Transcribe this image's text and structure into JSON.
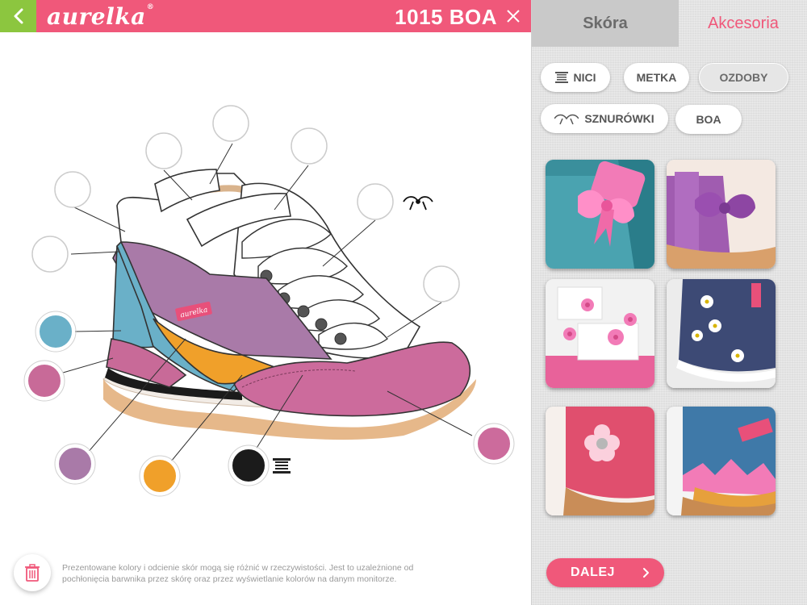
{
  "header": {
    "logo": "aurelka",
    "logo_mark": "®",
    "model_title": "1015 BOA"
  },
  "tabs": [
    {
      "label": "Skóra"
    },
    {
      "label": "Akcesoria"
    }
  ],
  "accessory_filters": [
    {
      "label": "NICI",
      "icon": "thread-spool-icon"
    },
    {
      "label": "METKA"
    },
    {
      "label": "OZDOBY"
    },
    {
      "label": "SZNURÓWKI",
      "icon": "shoelace-icon"
    },
    {
      "label": "BOA"
    }
  ],
  "thumbnails": [
    {
      "name": "pink-bow"
    },
    {
      "name": "purple-bow"
    },
    {
      "name": "pink-flowers-on-white-straps"
    },
    {
      "name": "white-flowers-on-navy"
    },
    {
      "name": "pink-flower-with-rivet"
    },
    {
      "name": "pink-crown-with-label"
    }
  ],
  "shoe_label": "aurelka",
  "swatches": {
    "blue": "#6ab0c8",
    "pink": "#c86a98",
    "purple": "#a97aa8",
    "orange": "#f0a02a",
    "black": "#1b1b1b",
    "rose": "#cc6b9c"
  },
  "colors": {
    "accent": "#f0587a",
    "back_button": "#8cc63f"
  },
  "disclaimer": "Prezentowane kolory i odcienie skór mogą się różnić w rzeczywistości. Jest to uzależnione od pochłonięcia barwnika przez skórę oraz przez wyświetlanie kolorów na danym monitorze.",
  "next_button": "DALEJ"
}
